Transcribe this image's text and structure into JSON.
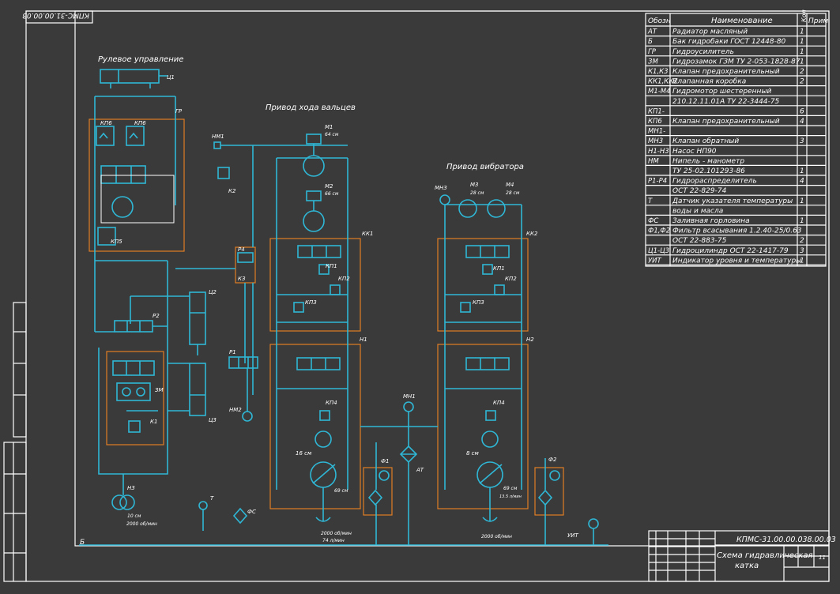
{
  "drawing": {
    "stamp_code": "КПМС-31.00.00.038.00.03",
    "stamp_code_rotated": "КПМС-31.00.00.03",
    "stamp_title_line1": "Схема гидравлическая",
    "stamp_title_line2": "катка",
    "sheet_count": "11",
    "corner_mark": "Б"
  },
  "headings": {
    "steering": "Рулевое управление",
    "rollers": "Привод хода вальцев",
    "vibrator": "Привод вибратора"
  },
  "spec_table": {
    "col_code": "Обозн",
    "col_name": "Наименование",
    "col_qty": "Кол",
    "col_note": "Прим",
    "rows": [
      {
        "code": "АТ",
        "name": "Радиатор масляный",
        "qty": "1"
      },
      {
        "code": "Б",
        "name": "Бак гидробаки ГОСТ 12448-80",
        "qty": "1"
      },
      {
        "code": "ГР",
        "name": "Гидроусилитель",
        "qty": "1"
      },
      {
        "code": "ЗМ",
        "name": "Гидрозамок ГЗМ ТУ 2-053-1828-87",
        "qty": "1"
      },
      {
        "code": "К1,К3",
        "name": "Клапан предохранительный",
        "qty": "2"
      },
      {
        "code": "КК1,КК2",
        "name": "Клапанная коробка",
        "qty": "2"
      },
      {
        "code": "М1-М4",
        "name": "Гидромотор шестеренный",
        "qty": ""
      },
      {
        "code": "",
        "name": "210.12.11.01А ТУ 22-3444-75",
        "qty": ""
      },
      {
        "code": "КП1-",
        "name": "",
        "qty": "6"
      },
      {
        "code": "КП6",
        "name": "Клапан предохранительный",
        "qty": "4"
      },
      {
        "code": "МН1-",
        "name": "",
        "qty": ""
      },
      {
        "code": "МН3",
        "name": "Клапан обратный",
        "qty": "3"
      },
      {
        "code": "Н1-Н3",
        "name": "Насос НП90",
        "qty": ""
      },
      {
        "code": "НМ",
        "name": "Нипель - манометр",
        "qty": ""
      },
      {
        "code": "",
        "name": "ТУ 25-02.101293-86",
        "qty": "1"
      },
      {
        "code": "Р1-Р4",
        "name": "Гидрораспределитель",
        "qty": "4"
      },
      {
        "code": "",
        "name": "ОСТ 22-829-74",
        "qty": ""
      },
      {
        "code": "Т",
        "name": "Датчик указателя температуры",
        "qty": "1"
      },
      {
        "code": "",
        "name": "воды и масла",
        "qty": ""
      },
      {
        "code": "ФС",
        "name": "Заливная горловина",
        "qty": "1"
      },
      {
        "code": "Ф1,Ф2",
        "name": "Фильтр всасывания 1.2.40-25/0.63",
        "qty": ""
      },
      {
        "code": "",
        "name": "ОСТ 22-883-75",
        "qty": "2"
      },
      {
        "code": "Ц1-Ц3",
        "name": "Гидроцилиндр ОСТ 22-1417-79",
        "qty": "3"
      },
      {
        "code": "УИТ",
        "name": "Индикатор уровня и температуры",
        "qty": "1"
      }
    ]
  },
  "labels": {
    "c1": "Ц1",
    "gr": "ГР",
    "kp6a": "КП6",
    "kp6b": "КП6",
    "kp5": "КП5",
    "nm1": "НМ1",
    "k2": "К2",
    "p4": "Р4",
    "kz": "КЗ",
    "m1": "М1",
    "m1sub": "64 см",
    "m2": "М2",
    "m2sub": "66 см",
    "c2": "Ц2",
    "p2": "Р2",
    "zm": "ЗМ",
    "k1": "К1",
    "c3": "Ц3",
    "p1": "Р1",
    "nm2": "НМ2",
    "kk1": "КК1",
    "kp1a": "КП1",
    "kp2a": "КП2",
    "kp3a": "КП3",
    "h1": "Н1",
    "kp4a": "КП4",
    "h1size": "16 см",
    "h1sub": "69 см",
    "h1flow": "2000 об/мин",
    "h1flow2": "74 л/мин",
    "mn1": "МН1",
    "at": "АТ",
    "f1": "Ф1",
    "mn3": "МН3",
    "m3": "М3",
    "m3sub": "28 см",
    "m4": "М4",
    "m4sub": "28 см",
    "kk2": "КК2",
    "kp1b": "КП1",
    "kp2b": "КП2",
    "kp3b": "КП3",
    "h2": "Н2",
    "kp4b": "КП4",
    "h2size": "8 см",
    "h2sub": "69 см",
    "h2sub2": "13.5 л/мин",
    "h2flow": "2000 об/мин",
    "f2": "Ф2",
    "uit": "УИТ",
    "h3": "Н3",
    "h3sub": "10 см",
    "h3flow": "2000 об/мин",
    "t": "Т",
    "fs": "ФС"
  },
  "colors": {
    "background": "#3a3a3a",
    "hydraulic_line": "#2fb7d6",
    "component_box": "#e07d24",
    "frame": "#ffffff"
  }
}
